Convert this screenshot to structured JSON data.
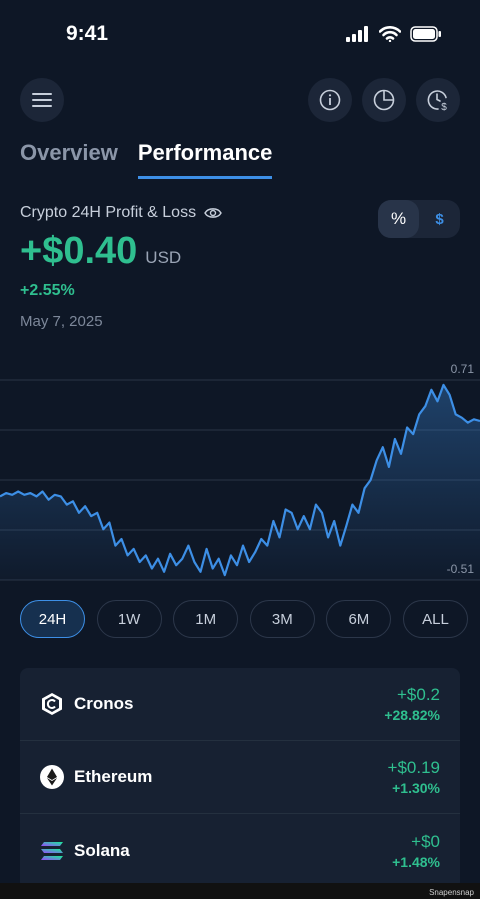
{
  "status_bar": {
    "time": "9:41"
  },
  "header": {
    "menu_icon": "hamburger-icon",
    "info_icon": "info-icon",
    "pie_icon": "pie-chart-icon",
    "history_icon": "clock-dollar-icon"
  },
  "tabs": [
    {
      "label": "Overview",
      "active": false
    },
    {
      "label": "Performance",
      "active": true
    }
  ],
  "pnl": {
    "title": "Crypto 24H Profit & Loss",
    "amount": "+$0.40",
    "currency": "USD",
    "pct_change": "+2.55%",
    "date": "May 7, 2025",
    "toggle_pct": "%",
    "toggle_usd": "$"
  },
  "chart_data": {
    "type": "area",
    "ymax_label": "0.71",
    "ymin_label": "-0.51",
    "ylim": [
      -0.51,
      0.71
    ],
    "values": [
      0.0,
      0.02,
      0.01,
      0.03,
      0.01,
      0.02,
      0.0,
      0.03,
      -0.02,
      0.01,
      0.0,
      -0.05,
      -0.03,
      -0.1,
      -0.06,
      -0.12,
      -0.1,
      -0.2,
      -0.16,
      -0.3,
      -0.26,
      -0.36,
      -0.32,
      -0.4,
      -0.36,
      -0.44,
      -0.38,
      -0.46,
      -0.35,
      -0.42,
      -0.38,
      -0.3,
      -0.4,
      -0.46,
      -0.32,
      -0.44,
      -0.38,
      -0.48,
      -0.36,
      -0.42,
      -0.3,
      -0.4,
      -0.34,
      -0.26,
      -0.3,
      -0.15,
      -0.25,
      -0.08,
      -0.1,
      -0.2,
      -0.12,
      -0.2,
      -0.05,
      -0.1,
      -0.25,
      -0.15,
      -0.3,
      -0.18,
      -0.05,
      -0.1,
      0.05,
      0.1,
      0.22,
      0.3,
      0.18,
      0.35,
      0.26,
      0.42,
      0.38,
      0.5,
      0.55,
      0.65,
      0.58,
      0.68,
      0.62,
      0.5,
      0.48,
      0.45,
      0.47,
      0.46
    ],
    "line_color": "#3d8fe6",
    "grid": true
  },
  "ranges": [
    {
      "label": "24H",
      "active": true
    },
    {
      "label": "1W",
      "active": false
    },
    {
      "label": "1M",
      "active": false
    },
    {
      "label": "3M",
      "active": false
    },
    {
      "label": "6M",
      "active": false
    },
    {
      "label": "ALL",
      "active": false
    }
  ],
  "assets": [
    {
      "name": "Cronos",
      "icon": "cronos-icon",
      "value": "+$0.2",
      "pct": "+28.82%"
    },
    {
      "name": "Ethereum",
      "icon": "ethereum-icon",
      "value": "+$0.19",
      "pct": "+1.30%"
    },
    {
      "name": "Solana",
      "icon": "solana-icon",
      "value": "+$0",
      "pct": "+1.48%"
    }
  ],
  "footer": {
    "watermark": "Snapensnap"
  },
  "colors": {
    "accent": "#3d8fe6",
    "positive": "#2fbf8f",
    "background": "#0e1726"
  }
}
